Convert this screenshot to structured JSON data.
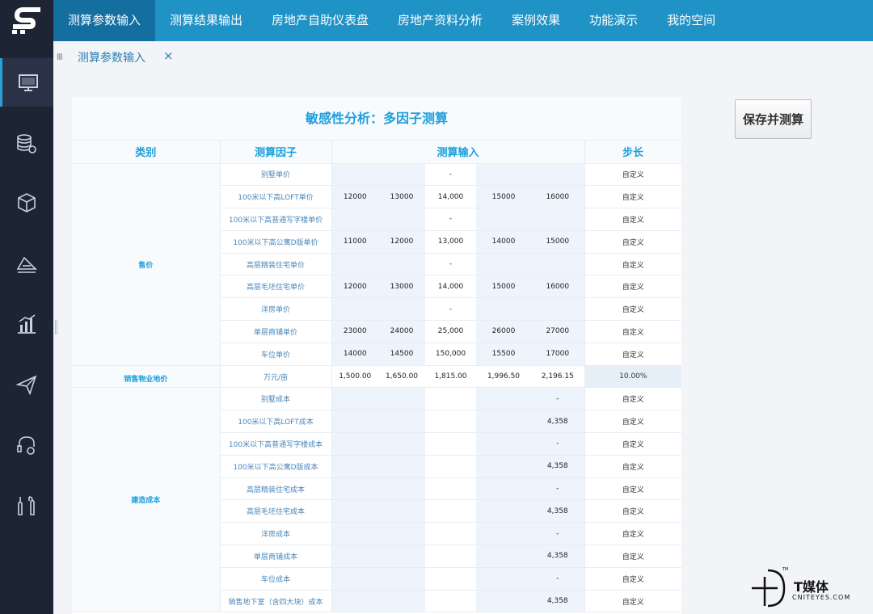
{
  "nav": {
    "items": [
      {
        "label": "测算参数输入",
        "active": true
      },
      {
        "label": "测算结果输出",
        "active": false
      },
      {
        "label": "房地产自助仪表盘",
        "active": false
      },
      {
        "label": "房地产资料分析",
        "active": false
      },
      {
        "label": "案例效果",
        "active": false
      },
      {
        "label": "功能演示",
        "active": false
      },
      {
        "label": "我的空间",
        "active": false
      }
    ]
  },
  "sidebar": {
    "icons": [
      "monitor-icon",
      "database-gear-icon",
      "cubes-icon",
      "layers-icon",
      "bar-chart-icon",
      "paper-plane-icon",
      "headset-gear-icon",
      "tools-icon"
    ]
  },
  "tab": {
    "grip": "III",
    "label": "测算参数输入",
    "close": "×"
  },
  "sheet": {
    "title": "敏感性分析：多因子测算",
    "headers": {
      "category": "类别",
      "factor": "测算因子",
      "input": "测算输入",
      "step": "步长"
    }
  },
  "actions": {
    "save_label": "保存并测算"
  },
  "rows": [
    {
      "factor": "别墅单价",
      "values": [
        "",
        "",
        "-",
        "",
        ""
      ],
      "step": "自定义"
    },
    {
      "factor": "100米以下高LOFT单价",
      "values": [
        "12000",
        "13000",
        "14,000",
        "15000",
        "16000"
      ],
      "step": "自定义"
    },
    {
      "factor": "100米以下高普通写字楼单价",
      "values": [
        "",
        "",
        "-",
        "",
        ""
      ],
      "step": "自定义"
    },
    {
      "factor": "100米以下高公寓D版单价",
      "values": [
        "11000",
        "12000",
        "13,000",
        "14000",
        "15000"
      ],
      "step": "自定义"
    },
    {
      "factor": "高层精装住宅单价",
      "values": [
        "",
        "",
        "-",
        "",
        ""
      ],
      "step": "自定义"
    },
    {
      "factor": "高层毛坯住宅单价",
      "values": [
        "12000",
        "13000",
        "14,000",
        "15000",
        "16000"
      ],
      "step": "自定义"
    },
    {
      "factor": "洋房单价",
      "values": [
        "",
        "",
        "-",
        "",
        ""
      ],
      "step": "自定义"
    },
    {
      "factor": "单层商铺单价",
      "values": [
        "23000",
        "24000",
        "25,000",
        "26000",
        "27000"
      ],
      "step": "自定义"
    },
    {
      "factor": "车位单价",
      "values": [
        "14000",
        "14500",
        "150,000",
        "15500",
        "17000"
      ],
      "step": "自定义"
    },
    {
      "factor": "万元/亩",
      "values": [
        "1,500.00",
        "1,650.00",
        "1,815.00",
        "1,996.50",
        "2,196.15"
      ],
      "step": "10.00%"
    },
    {
      "factor": "别墅成本",
      "values": [
        "",
        "",
        "",
        "",
        "-"
      ],
      "step": "自定义"
    },
    {
      "factor": "100米以下高LOFT成本",
      "values": [
        "",
        "",
        "",
        "",
        "4,358"
      ],
      "step": "自定义"
    },
    {
      "factor": "100米以下高普通写字楼成本",
      "values": [
        "",
        "",
        "",
        "",
        "-"
      ],
      "step": "自定义"
    },
    {
      "factor": "100米以下高公寓D版成本",
      "values": [
        "",
        "",
        "",
        "",
        "4,358"
      ],
      "step": "自定义"
    },
    {
      "factor": "高层精装住宅成本",
      "values": [
        "",
        "",
        "",
        "",
        "-"
      ],
      "step": "自定义"
    },
    {
      "factor": "高层毛坯住宅成本",
      "values": [
        "",
        "",
        "",
        "",
        "4,358"
      ],
      "step": "自定义"
    },
    {
      "factor": "洋房成本",
      "values": [
        "",
        "",
        "",
        "",
        "-"
      ],
      "step": "自定义"
    },
    {
      "factor": "单层商铺成本",
      "values": [
        "",
        "",
        "",
        "",
        "4,358"
      ],
      "step": "自定义"
    },
    {
      "factor": "车位成本",
      "values": [
        "",
        "",
        "",
        "",
        "-"
      ],
      "step": "自定义"
    },
    {
      "factor": "销售地下室（含四大块）成本",
      "values": [
        "",
        "",
        "",
        "",
        "4,358"
      ],
      "step": "自定义"
    }
  ],
  "categories": [
    {
      "label": "售价",
      "start": 0,
      "span": 9
    },
    {
      "label": "销售物业地价",
      "start": 9,
      "span": 1
    },
    {
      "label": "建造成本",
      "start": 10,
      "span": 10
    }
  ],
  "watermark": {
    "brand": "T媒体",
    "site": "CNITEYES.COM",
    "tm": "TM"
  }
}
